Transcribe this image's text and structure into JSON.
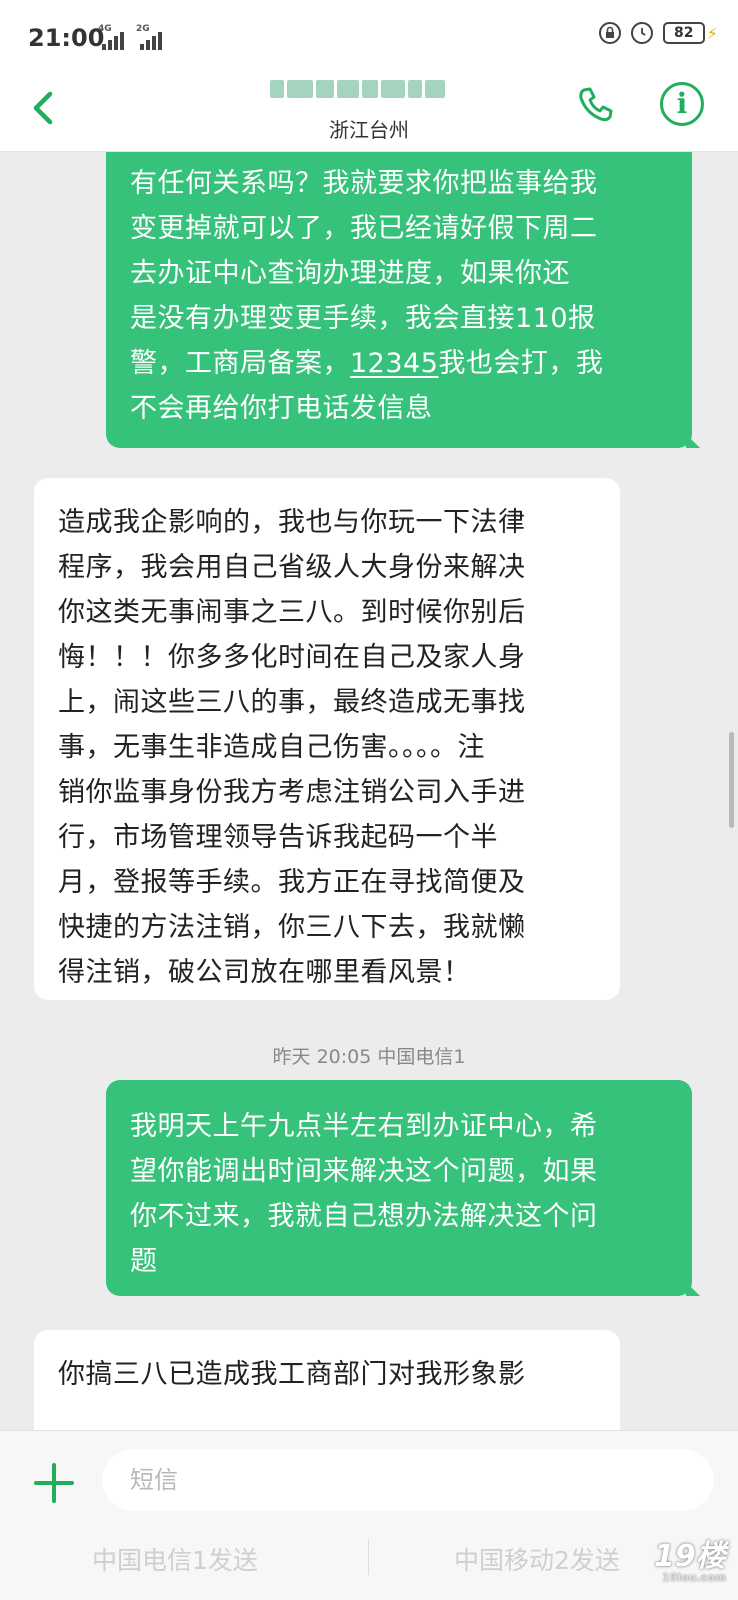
{
  "status_bar": {
    "time": "21:00",
    "network_1": "4G",
    "network_2": "2G",
    "battery": "82"
  },
  "header": {
    "location": "浙江台州"
  },
  "messages": [
    {
      "direction": "sent",
      "lines": [
        "有任何关系吗？我就要求你把监事给我",
        "变更掉就可以了，我已经请好假下周二",
        "去办证中心查询办理进度，如果你还",
        "是没有办理变更手续，我会直接110报",
        "警，工商局备案，",
        "12345",
        "我也会打，我",
        "不会再给你打电话发信息"
      ]
    },
    {
      "direction": "received",
      "lines": [
        "造成我企影响的，我也与你玩一下法律",
        "程序，我会用自己省级人大身份来解决",
        "你这类无事闹事之三八。到时候你别后",
        "悔！！！你多多化时间在自己及家人身",
        "上，闹这些三八的事，最终造成无事找",
        "事，无事生非造成自己伤害。。。。注",
        "销你监事身份我方考虑注销公司入手进",
        "行，市场管理领导告诉我起码一个半",
        "月，登报等手续。我方正在寻找简便及",
        "快捷的方法注销，你三八下去，我就懒",
        "得注销，破公司放在哪里看风景！"
      ]
    },
    {
      "direction": "timestamp",
      "text": "昨天 20:05  中国电信1"
    },
    {
      "direction": "sent",
      "lines": [
        "我明天上午九点半左右到办证中心，希",
        "望你能调出时间来解决这个问题，如果",
        "你不过来，我就自己想办法解决这个问",
        "题"
      ]
    },
    {
      "direction": "received",
      "lines": [
        "你搞三八已造成我工商部门对我形象影"
      ]
    }
  ],
  "composer": {
    "placeholder": "短信",
    "send_sim1": "中国电信1发送",
    "send_sim2": "中国移动2发送"
  },
  "watermark": {
    "main": "19楼",
    "sub": "19lou.com"
  },
  "colors": {
    "sent_bubble": "#36c27a",
    "accent": "#1fae5c",
    "background": "#ececec"
  }
}
